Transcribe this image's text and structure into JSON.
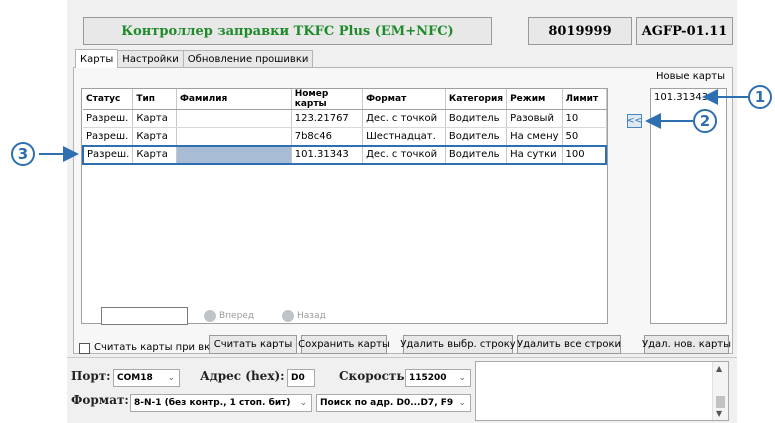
{
  "header": {
    "title": "Контроллер заправки TKFC Plus (EM+NFC)",
    "serial": "8019999",
    "version": "AGFP-01.11"
  },
  "tabs": [
    {
      "label": "Карты",
      "active": true
    },
    {
      "label": "Настройки",
      "active": false
    },
    {
      "label": "Обновление прошивки",
      "active": false
    }
  ],
  "table": {
    "columns": [
      "Статус",
      "Тип",
      "Фамилия",
      "Номер карты",
      "Формат",
      "Категория",
      "Режим",
      "Лимит"
    ],
    "rows": [
      [
        "Разреш.",
        "Карта",
        "",
        "123.21767",
        "Дес. с точкой",
        "Водитель",
        "Разовый",
        "10"
      ],
      [
        "Разреш.",
        "Карта",
        "",
        "7b8c46",
        "Шестнадцат.",
        "Водитель",
        "На смену",
        "50"
      ],
      [
        "Разреш.",
        "Карта",
        "",
        "101.31343",
        "Дес. с точкой",
        "Водитель",
        "На сутки",
        "100"
      ]
    ],
    "selected_row": 2
  },
  "pager": {
    "forward_label": "Вперед",
    "back_label": "Назад"
  },
  "new_cards": {
    "label": "Новые карты",
    "items": [
      "101.31343"
    ],
    "move_label": "<<"
  },
  "actions": {
    "read_on_start_label": "Считать карты при вкл.",
    "read_on_start_checked": false,
    "read_label": "Считать карты",
    "save_label": "Сохранить карты",
    "delete_selected_label": "Удалить выбр. строку",
    "delete_all_label": "Удалить все строки",
    "delete_new_label": "Удал. нов. карты"
  },
  "connection": {
    "port_label": "Порт:",
    "port_value": "COM18",
    "address_label": "Адрес (hex):",
    "address_value": "D0",
    "speed_label": "Скорость:",
    "speed_value": "115200",
    "format_label": "Формат:",
    "format_value": "8-N-1 (без контр., 1 стоп. бит)",
    "search_value": "Поиск по адр. D0...D7, F9"
  },
  "callouts": [
    "1",
    "2",
    "3"
  ],
  "colors": {
    "title": "#1e8a2a",
    "accent": "#2d6fb0",
    "selection": "#a9bcd6"
  }
}
